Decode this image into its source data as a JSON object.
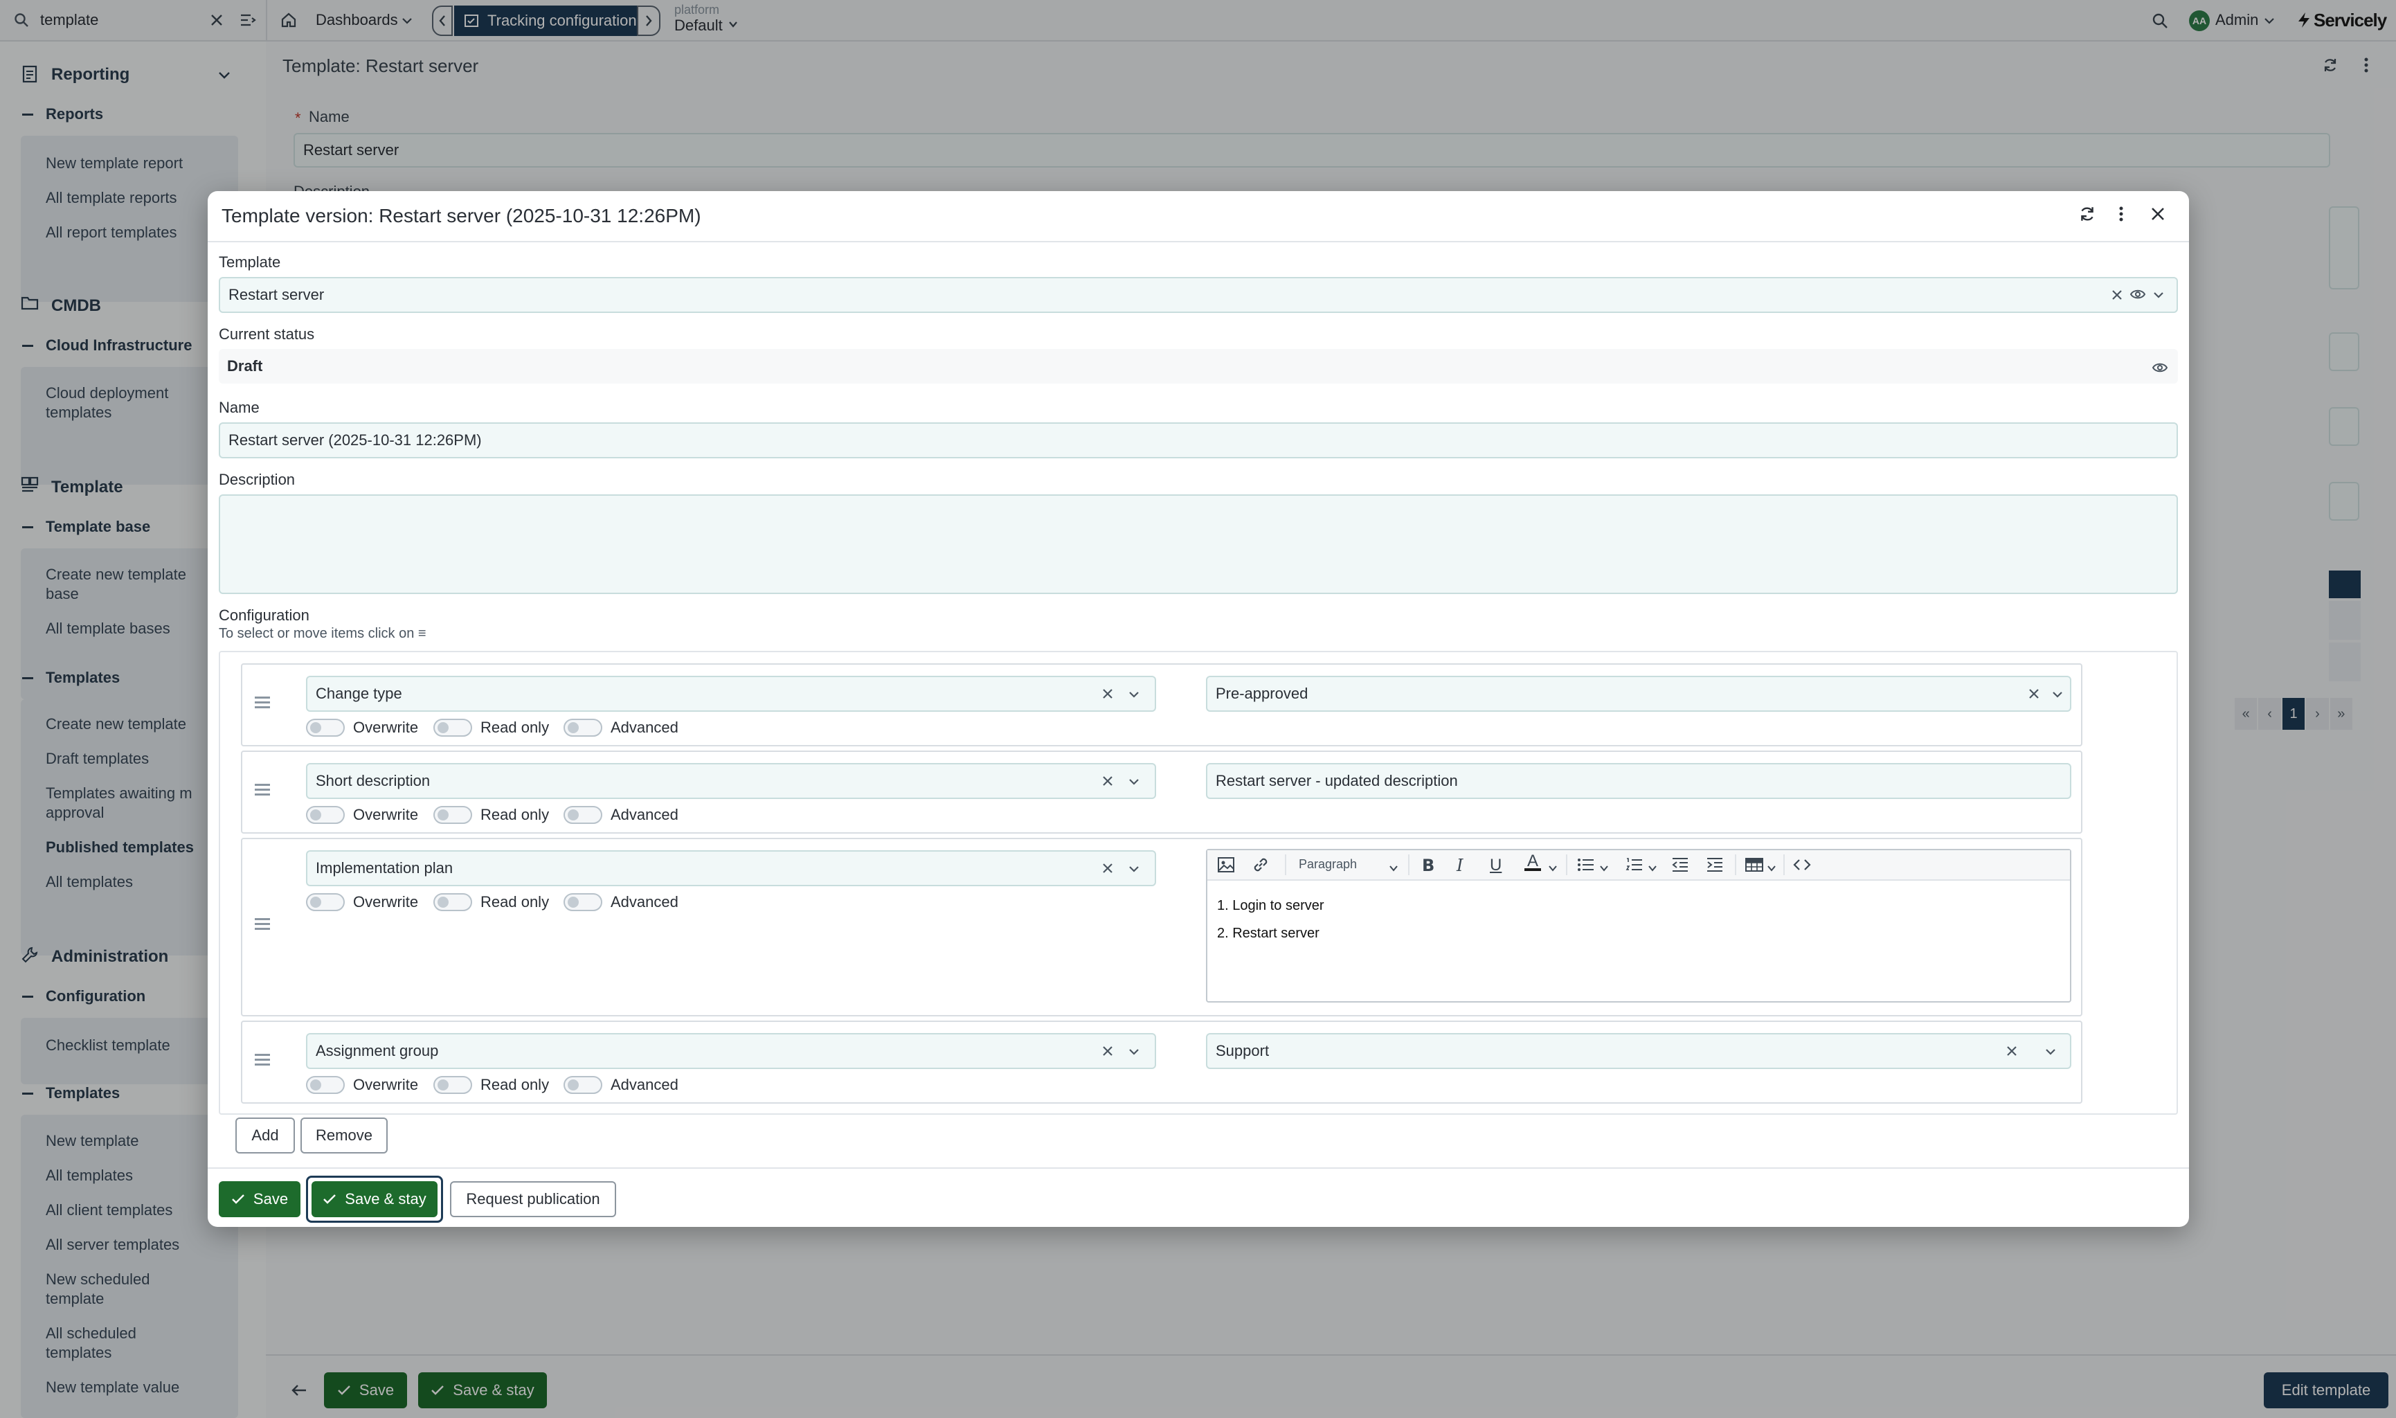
{
  "topbar": {
    "search_value": "template",
    "dashboards_label": "Dashboards",
    "tracking_label": "Tracking configuration",
    "platform_label": "platform",
    "platform_value": "Default",
    "user_initials": "AA",
    "user_name": "Admin",
    "brand": "Servicely"
  },
  "sidebar": {
    "reporting": "Reporting",
    "reports": "Reports",
    "reports_items": [
      "New template report",
      "All template reports",
      "All report templates"
    ],
    "cmdb": "CMDB",
    "cloud_infra": "Cloud Infrastructure",
    "cloud_items": [
      "Cloud deployment",
      "templates"
    ],
    "template": "Template",
    "template_base": "Template base",
    "template_base_items": [
      "Create new template",
      "base",
      "All template bases"
    ],
    "templates": "Templates",
    "templates_items": [
      "Create new template",
      "Draft templates",
      "Templates awaiting m",
      "approval",
      "Published templates",
      "All templates"
    ],
    "administration": "Administration",
    "configuration": "Configuration",
    "configuration_items": [
      "Checklist template"
    ],
    "templates2": "Templates",
    "templates2_items": [
      "New template",
      "All templates",
      "All client templates",
      "All server templates",
      "New scheduled",
      "template",
      "All scheduled",
      "templates",
      "New template value"
    ]
  },
  "background_page": {
    "title": "Template: Restart server",
    "name_label": "Name",
    "name_value": "Restart server",
    "description_label": "Description",
    "pagination_current": "1",
    "save_label": "Save",
    "save_stay_label": "Save & stay",
    "edit_template_label": "Edit template"
  },
  "modal": {
    "title": "Template version: Restart server (2025-10-31 12:26PM)",
    "template_label": "Template",
    "template_value": "Restart server",
    "status_label": "Current status",
    "status_value": "Draft",
    "name_label": "Name",
    "name_value": "Restart server (2025-10-31 12:26PM)",
    "description_label": "Description",
    "description_value": "",
    "configuration_label": "Configuration",
    "configuration_hint": "To select or move items click on ≡",
    "rows": [
      {
        "field": "Change type",
        "value": "Pre-approved"
      },
      {
        "field": "Short description",
        "value": "Restart server - updated description"
      },
      {
        "field": "Implementation plan",
        "editor_lines": [
          "1. Login to server",
          "2. Restart server"
        ],
        "paragraph_style": "Paragraph"
      },
      {
        "field": "Assignment group",
        "value": "Support"
      }
    ],
    "toggle_labels": [
      "Overwrite",
      "Read only",
      "Advanced"
    ],
    "add_label": "Add",
    "remove_label": "Remove",
    "save_label": "Save",
    "save_stay_label": "Save & stay",
    "request_publication_label": "Request publication"
  },
  "colors": {
    "accent_green": "#1d6b2c",
    "active_nav": "#1d3b56",
    "field_bg": "#f1f8f8"
  }
}
